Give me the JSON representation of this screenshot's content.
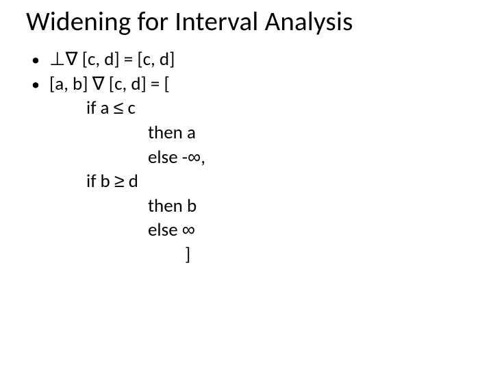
{
  "title": "Widening for Interval Analysis",
  "bullet_glyph": "•",
  "line1": {
    "sym_prefix": "⊥∇",
    "rest": " [c, d] = [c, d]"
  },
  "line2": {
    "left": "[a, b] ",
    "op": "∇",
    "right": " [c, d] = ["
  },
  "if1": {
    "label": "if a ",
    "rel": "≤",
    "rhs": " c"
  },
  "then_a": "then a",
  "else_inf_neg": {
    "pre": "else -",
    "inf": "∞",
    "post": ","
  },
  "if2": {
    "label": "if b ",
    "rel": "≥",
    "rhs": " d"
  },
  "then_b": "then b",
  "else_inf_pos": {
    "pre": "else ",
    "inf": "∞"
  },
  "close": "]"
}
